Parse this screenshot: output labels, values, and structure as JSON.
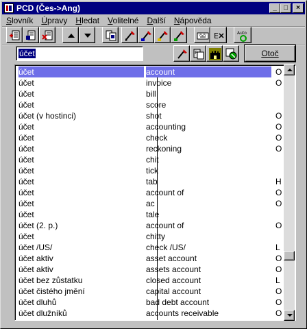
{
  "window": {
    "title": "PCD (Čes->Ang)"
  },
  "menu": [
    {
      "pre": "",
      "key": "S",
      "post": "lovník"
    },
    {
      "pre": "",
      "key": "Ú",
      "post": "pravy"
    },
    {
      "pre": "",
      "key": "H",
      "post": "ledat"
    },
    {
      "pre": "",
      "key": "V",
      "post": "olitelné"
    },
    {
      "pre": "",
      "key": "D",
      "post": "alší"
    },
    {
      "pre": "",
      "key": "N",
      "post": "ápověda"
    }
  ],
  "search": {
    "value": "účet"
  },
  "buttons": {
    "otoc": "Otoč",
    "auto": "Auto"
  },
  "rows": [
    {
      "cz": "účet",
      "en": "account",
      "flag": "O"
    },
    {
      "cz": "účet",
      "en": "invoice",
      "flag": "O"
    },
    {
      "cz": "účet",
      "en": "bill",
      "flag": ""
    },
    {
      "cz": "účet",
      "en": "score",
      "flag": ""
    },
    {
      "cz": "účet (v hostinci)",
      "en": "shot",
      "flag": "O"
    },
    {
      "cz": "účet",
      "en": "accounting",
      "flag": "O"
    },
    {
      "cz": "účet",
      "en": "check",
      "flag": "O"
    },
    {
      "cz": "účet",
      "en": "reckoning",
      "flag": "O"
    },
    {
      "cz": "účet",
      "en": "chit",
      "flag": ""
    },
    {
      "cz": "účet",
      "en": "tick",
      "flag": ""
    },
    {
      "cz": "účet",
      "en": "tab",
      "flag": "H"
    },
    {
      "cz": "účet",
      "en": "account of",
      "flag": "O"
    },
    {
      "cz": "účet",
      "en": "ac",
      "flag": "O"
    },
    {
      "cz": "účet",
      "en": "tale",
      "flag": ""
    },
    {
      "cz": "účet (2. p.)",
      "en": "account of",
      "flag": "O"
    },
    {
      "cz": "účet",
      "en": "chitty",
      "flag": ""
    },
    {
      "cz": "účet /US/",
      "en": "check /US/",
      "flag": "L"
    },
    {
      "cz": "účet aktiv",
      "en": "asset account",
      "flag": "O"
    },
    {
      "cz": "účet aktiv",
      "en": "assets account",
      "flag": "O"
    },
    {
      "cz": "účet bez zůstatku",
      "en": "closed account",
      "flag": "L"
    },
    {
      "cz": "účet čistého jmění",
      "en": "capital account",
      "flag": "O"
    },
    {
      "cz": "účet dluhů",
      "en": "bad debt account",
      "flag": "O"
    },
    {
      "cz": "účet dlužníků",
      "en": "accounts receivable",
      "flag": "O"
    }
  ],
  "selected_row": 0,
  "scroll": {
    "position": 0.78
  }
}
